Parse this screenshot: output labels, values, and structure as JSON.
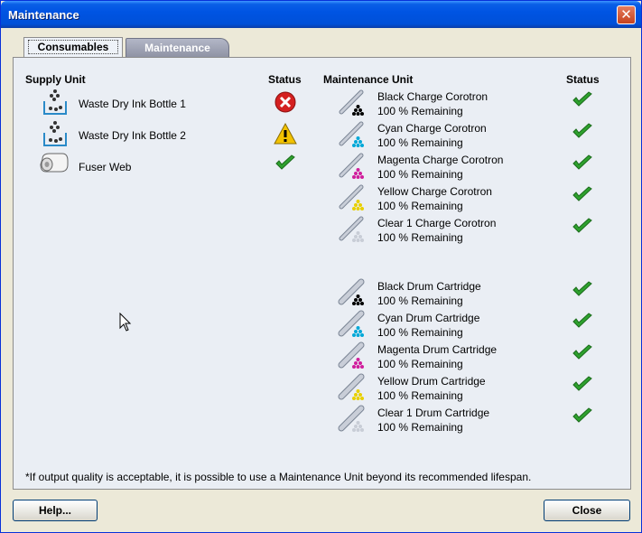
{
  "window": {
    "title": "Maintenance",
    "close_glyph": "✕"
  },
  "tabs": [
    {
      "label": "Consumables",
      "active": true
    },
    {
      "label": "Maintenance",
      "active": false
    }
  ],
  "supply": {
    "header": "Supply Unit",
    "status_header": "Status",
    "items": [
      {
        "name": "Waste Dry Ink Bottle 1",
        "icon": "waste-bottle-icon",
        "status": "error"
      },
      {
        "name": "Waste Dry Ink Bottle 2",
        "icon": "waste-bottle-icon",
        "status": "warning"
      },
      {
        "name": "Fuser Web",
        "icon": "fuser-web-icon",
        "status": "ok"
      }
    ]
  },
  "maintenance": {
    "header": "Maintenance Unit",
    "status_header": "Status",
    "corotrons": [
      {
        "name": "Black Charge Corotron",
        "remaining": "100 % Remaining",
        "color": "#000000",
        "status": "ok"
      },
      {
        "name": "Cyan Charge Corotron",
        "remaining": "100 % Remaining",
        "color": "#00a8d8",
        "status": "ok"
      },
      {
        "name": "Magenta Charge Corotron",
        "remaining": "100 % Remaining",
        "color": "#d01e9c",
        "status": "ok"
      },
      {
        "name": "Yellow Charge Corotron",
        "remaining": "100 % Remaining",
        "color": "#e8d000",
        "status": "ok"
      },
      {
        "name": "Clear 1 Charge Corotron",
        "remaining": "100 % Remaining",
        "color": "#c8cdd6",
        "status": "ok"
      }
    ],
    "drums": [
      {
        "name": "Black Drum Cartridge",
        "remaining": "100 % Remaining",
        "color": "#000000",
        "status": "ok"
      },
      {
        "name": "Cyan Drum Cartridge",
        "remaining": "100 % Remaining",
        "color": "#00a8d8",
        "status": "ok"
      },
      {
        "name": "Magenta Drum Cartridge",
        "remaining": "100 % Remaining",
        "color": "#d01e9c",
        "status": "ok"
      },
      {
        "name": "Yellow Drum Cartridge",
        "remaining": "100 % Remaining",
        "color": "#e8d000",
        "status": "ok"
      },
      {
        "name": "Clear 1 Drum Cartridge",
        "remaining": "100 % Remaining",
        "color": "#c8cdd6",
        "status": "ok"
      }
    ]
  },
  "footnote": "*If output quality is acceptable, it is possible to use a Maintenance Unit beyond its recommended lifespan.",
  "buttons": {
    "help": "Help...",
    "close": "Close"
  },
  "colors": {
    "ok": "#2ea12e",
    "error": "#d42020",
    "warning": "#f2c200",
    "titlebar": "#0054e3"
  }
}
